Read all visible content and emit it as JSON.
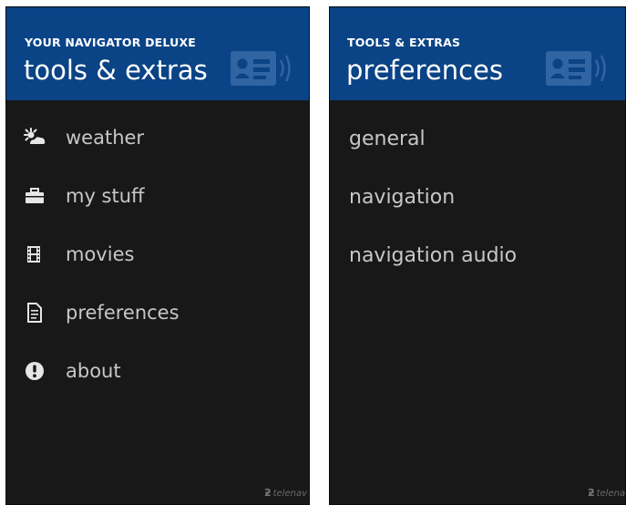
{
  "left_screen": {
    "header": {
      "app_name": "YOUR NAVIGATOR DELUXE",
      "title": "tools & extras"
    },
    "menu": [
      {
        "label": "weather",
        "icon": "weather-icon"
      },
      {
        "label": "my stuff",
        "icon": "briefcase-icon"
      },
      {
        "label": "movies",
        "icon": "film-icon"
      },
      {
        "label": "preferences",
        "icon": "document-icon"
      },
      {
        "label": "about",
        "icon": "info-icon"
      }
    ],
    "brand": "telenav"
  },
  "right_screen": {
    "header": {
      "breadcrumb": "TOOLS & EXTRAS",
      "title": "preferences"
    },
    "items": [
      {
        "label": "general"
      },
      {
        "label": "navigation"
      },
      {
        "label": "navigation audio"
      }
    ],
    "brand": "telenav"
  },
  "colors": {
    "header_blue": "#0a4386",
    "background": "#171817",
    "item_text": "#c7c7c7"
  }
}
